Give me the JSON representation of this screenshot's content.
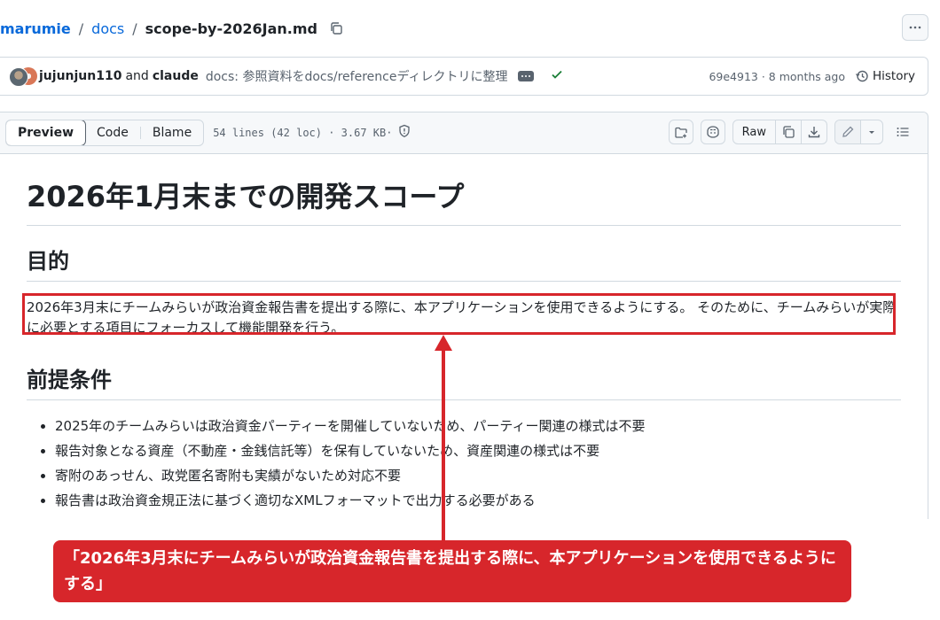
{
  "breadcrumb": {
    "owner": "marumie",
    "folder": "docs",
    "file": "scope-by-2026Jan.md"
  },
  "commit": {
    "author1": "jujunjun110",
    "and_label": "and",
    "author2": "claude",
    "message": "docs: 参照資料をdocs/referenceディレクトリに整理",
    "sha_time": "69e4913 · 8 months ago",
    "history_label": "History",
    "status_color": "#1a7f37"
  },
  "file_header": {
    "tabs": [
      "Preview",
      "Code",
      "Blame"
    ],
    "active_tab": "Preview",
    "meta": "54 lines (42 loc) · 3.67 KB·",
    "raw_label": "Raw"
  },
  "markdown": {
    "h1": "2026年1月末までの開発スコープ",
    "h2_purpose": "目的",
    "purpose_text": "2026年3月末にチームみらいが政治資金報告書を提出する際に、本アプリケーションを使用できるようにする。 そのために、チームみらいが実際に必要とする項目にフォーカスして機能開発を行う。",
    "h2_prereq": "前提条件",
    "prereq_items": [
      "2025年のチームみらいは政治資金パーティーを開催していないため、パーティー関連の様式は不要",
      "報告対象となる資産（不動産・金銭信託等）を保有していないため、資産関連の様式は不要",
      "寄附のあっせん、政党匿名寄附も実績がないため対応不要",
      "報告書は政治資金規正法に基づく適切なXMLフォーマットで出力する必要がある"
    ]
  },
  "annotation": {
    "callout_text": "「2026年3月末にチームみらいが政治資金報告書を提出する際に、本アプリケーションを使用できるようにする」",
    "accent_color": "#d7262b"
  },
  "icons": [
    "copy-icon",
    "kebab-icon",
    "ellipsis-icon",
    "check-icon",
    "history-icon",
    "shield-icon",
    "new-file-icon",
    "copilot-icon",
    "copy-raw-icon",
    "download-icon",
    "pencil-icon",
    "chevron-down-icon",
    "list-icon"
  ]
}
